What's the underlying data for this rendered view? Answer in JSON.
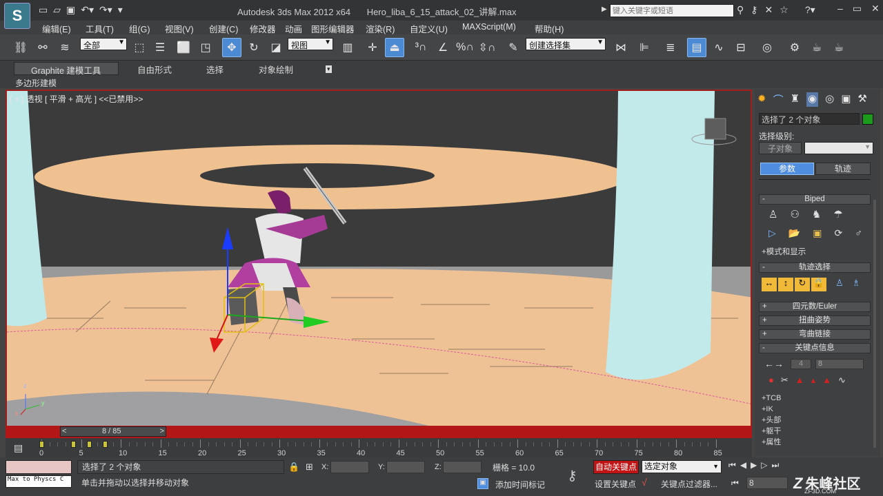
{
  "app": {
    "title": "Autodesk 3ds Max  2012 x64",
    "file": "Hero_liba_6_15_attack_02_讲解.max",
    "search_placeholder": "键入关键字或短语"
  },
  "menu": [
    "编辑(E)",
    "工具(T)",
    "组(G)",
    "视图(V)",
    "创建(C)",
    "修改器",
    "动画",
    "图形编辑器",
    "渲染(R)",
    "自定义(U)",
    "MAXScript(M)",
    "帮助(H)"
  ],
  "toolbar": {
    "filter": "全部",
    "refcoord": "视图",
    "named_selection": "创建选择集"
  },
  "ribbon": {
    "tabs": [
      "Graphite 建模工具",
      "自由形式",
      "选择",
      "对象绘制"
    ],
    "sub": "多边形建模"
  },
  "viewport": {
    "label": "[ + ] 透视 [ 平滑 + 高光 ] <<已禁用>>",
    "axis_z": "z",
    "axis_x": "x",
    "axis_y": "y"
  },
  "command": {
    "name": "选择了 2 个对象",
    "sel_level_label": "选择级别:",
    "sub_obj": "子对象",
    "tab_param": "参数",
    "tab_motion": "轨迹",
    "rollouts": {
      "biped": "Biped",
      "mode_display": "+模式和显示",
      "track_select": "轨迹选择",
      "quaternion": "四元数/Euler",
      "twist": "扭曲姿势",
      "bend": "弯曲链接",
      "key_info": "关键点信息"
    },
    "key_prev": "4",
    "key_num": "8",
    "params": [
      "+TCB",
      "+IK",
      "+头部",
      "+躯干",
      "+属性"
    ]
  },
  "time": {
    "slider": "8 / 85",
    "ticks": [
      "0",
      "5",
      "10",
      "15",
      "20",
      "25",
      "30",
      "35",
      "40",
      "45",
      "50",
      "55",
      "60",
      "65",
      "70",
      "75",
      "80",
      "85"
    ]
  },
  "status": {
    "script": "Max to Physcs C",
    "selected": "选择了 2 个对象",
    "prompt": "单击并拖动以选择并移动对象",
    "x_label": "X:",
    "y_label": "Y:",
    "z_label": "Z:",
    "grid": "栅格 = 10.0",
    "add_tag": "添加时间标记",
    "autokey": "自动关键点",
    "setkey": "设置关键点",
    "sel_mode": "选定对象",
    "key_filter": "关键点过滤器...",
    "frame": "8"
  },
  "watermark": "朱峰社区",
  "watermark_url": "ZF3D.COM"
}
